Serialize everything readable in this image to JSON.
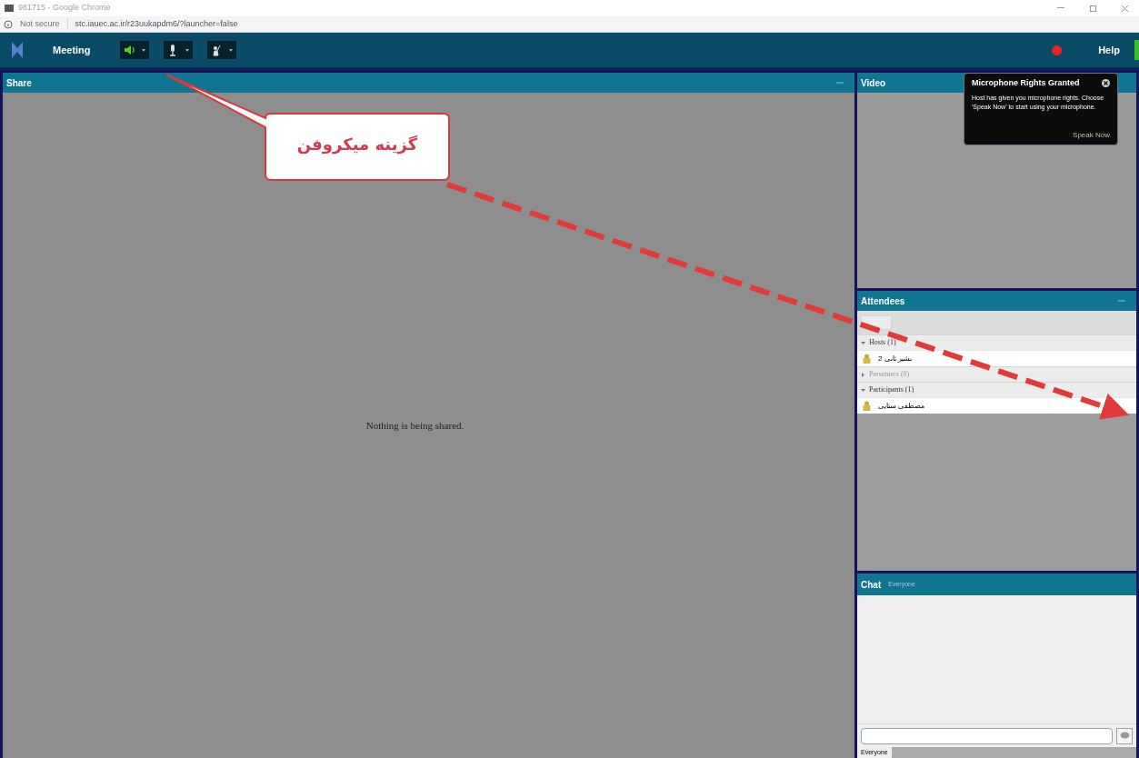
{
  "window": {
    "title": "981715 - Google Chrome",
    "security": "Not secure",
    "url": "stc.iauec.ac.ir/r23uukapdm6/?launcher=false"
  },
  "toolbar": {
    "title": "Meeting",
    "buttons": [
      {
        "kind": "speaker"
      },
      {
        "kind": "mic"
      },
      {
        "kind": "hand"
      }
    ],
    "help": "Help"
  },
  "share": {
    "title": "Share",
    "message": "Nothing is being shared."
  },
  "video": {
    "title": "Video"
  },
  "notification": {
    "title": "Microphone Rights Granted",
    "message": "Host has given you microphone rights. Choose 'Speak Now' to start using your microphone.",
    "action": "Speak Now"
  },
  "attendees": {
    "title": "Attendees",
    "groups": [
      {
        "label": "Hosts (1)",
        "expanded": true,
        "people": [
          {
            "name": "بشیر ثانی 2"
          }
        ]
      },
      {
        "label": "Presenters (0)",
        "expanded": false
      },
      {
        "label": "Participants (1)",
        "expanded": true,
        "people": [
          {
            "name": "مصطفی ستایی"
          }
        ]
      }
    ]
  },
  "chat": {
    "title": "Chat",
    "subtitle": "Everyone",
    "tab": "Everyone"
  },
  "annotation": {
    "text": "گزینه میکروفن"
  }
}
